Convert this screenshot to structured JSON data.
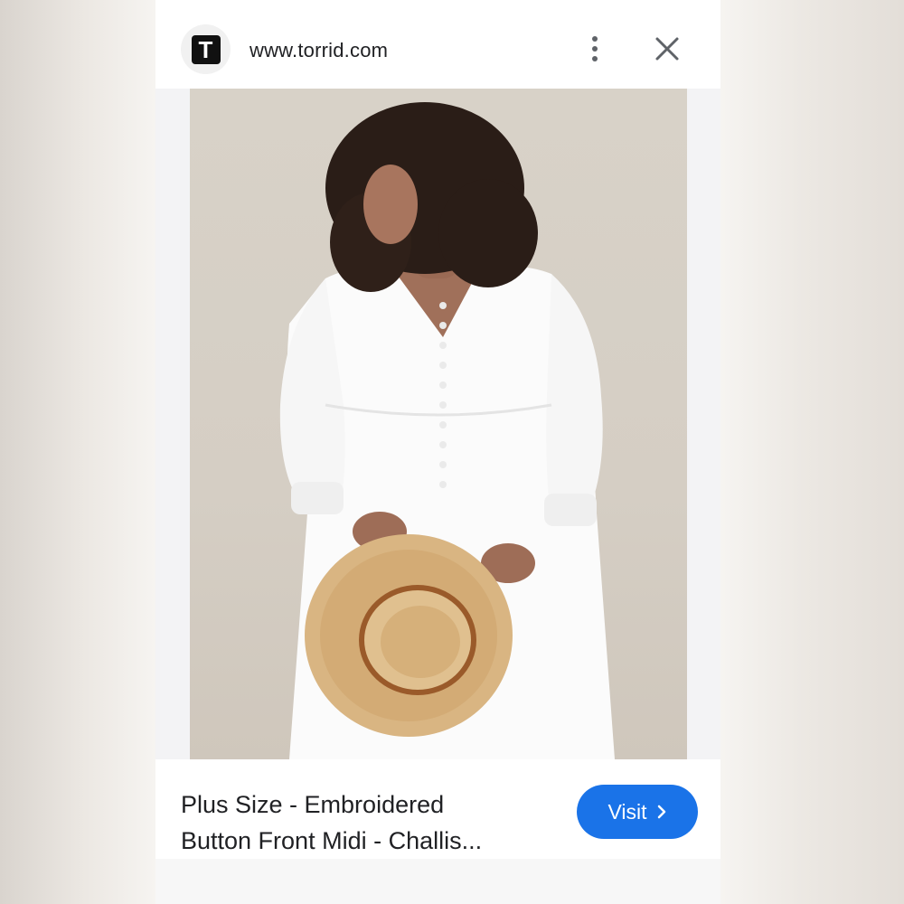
{
  "header": {
    "logo_letter": "T",
    "url": "www.torrid.com"
  },
  "product": {
    "title_line1": "Plus Size - Embroidered",
    "title_line2": "Button Front Midi - Challis..."
  },
  "actions": {
    "visit_label": "Visit"
  },
  "colors": {
    "accent": "#1a73e8",
    "text": "#202124",
    "icon": "#5f6368"
  },
  "icons": {
    "site": "torrid-logo-icon",
    "menu": "more-vert-icon",
    "close": "close-icon",
    "visit": "chevron-right-icon"
  }
}
